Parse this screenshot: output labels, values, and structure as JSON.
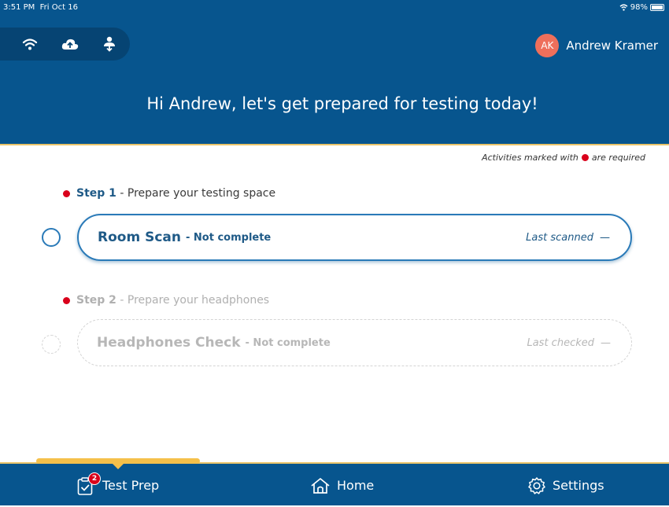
{
  "status_bar": {
    "time": "3:51 PM",
    "date": "Fri Oct 16",
    "battery": "98%"
  },
  "header": {
    "connection_icons": [
      "wifi-icon",
      "cloud-upload-icon",
      "user-download-icon"
    ],
    "user": {
      "initials": "AK",
      "name": "Andrew Kramer"
    },
    "greeting": "Hi Andrew, let's get prepared for testing today!"
  },
  "required_note": {
    "prefix": "Activities marked with",
    "suffix": "are required"
  },
  "steps": [
    {
      "number": "Step 1",
      "title": "- Prepare your testing space",
      "card_title": "Room Scan",
      "card_status": "- Not complete",
      "right_label": "Last scanned",
      "right_value": "—"
    },
    {
      "number": "Step 2",
      "title": "- Prepare your headphones",
      "card_title": "Headphones Check",
      "card_status": "- Not complete",
      "right_label": "Last checked",
      "right_value": "—"
    }
  ],
  "tabs": [
    {
      "label": "Test Prep",
      "icon": "clipboard-check-icon",
      "badge": "2"
    },
    {
      "label": "Home",
      "icon": "home-icon"
    },
    {
      "label": "Settings",
      "icon": "gear-icon"
    }
  ],
  "colors": {
    "header_bg": "#07558e",
    "accent_gold": "#f5c04a",
    "required_red": "#d9001b",
    "avatar_bg": "#ee6f5b",
    "active_blue": "#2a7ab8"
  }
}
